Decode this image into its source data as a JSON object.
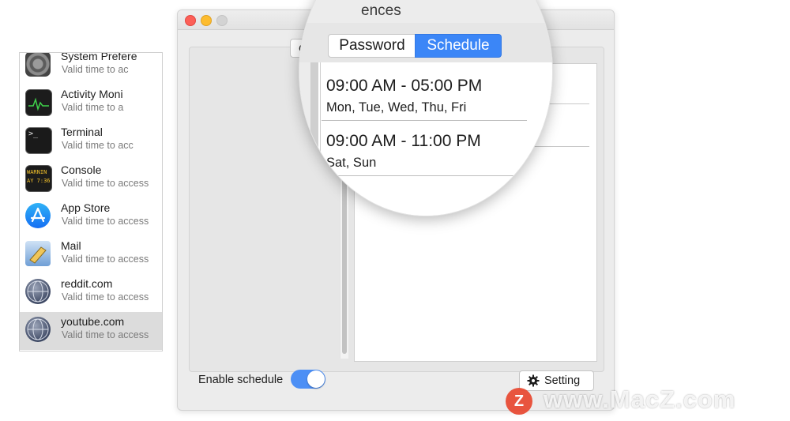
{
  "window": {
    "title_fragment": "ences",
    "tab_partial": "Gen"
  },
  "apps": [
    {
      "name": "System Prefere",
      "sub": "Valid time to ac",
      "icon": "system-preferences-icon"
    },
    {
      "name": "Activity Moni",
      "sub": "Valid time to a",
      "icon": "activity-monitor-icon"
    },
    {
      "name": "Terminal",
      "sub": "Valid time to acc",
      "icon": "terminal-icon"
    },
    {
      "name": "Console",
      "sub": "Valid time to access",
      "icon": "console-icon"
    },
    {
      "name": "App Store",
      "sub": "Valid time to access",
      "icon": "app-store-icon"
    },
    {
      "name": "Mail",
      "sub": "Valid time to access",
      "icon": "mail-icon"
    },
    {
      "name": "reddit.com",
      "sub": "Valid time to access",
      "icon": "globe-icon"
    },
    {
      "name": "youtube.com",
      "sub": "Valid time to access",
      "icon": "globe-icon",
      "selected": true
    }
  ],
  "icon_text": {
    "terminal": ">_",
    "console_line1": "WARNIN",
    "console_line2": "AY 7:36"
  },
  "magnifier": {
    "tabs": [
      {
        "label": "Password",
        "active": false
      },
      {
        "label": "Schedule",
        "active": true
      }
    ],
    "schedules": [
      {
        "time": "09:00 AM  -  05:00 PM",
        "days": "Mon, Tue, Wed, Thu, Fri"
      },
      {
        "time": "09:00 AM  -  11:00 PM",
        "days": "Sat, Sun"
      }
    ]
  },
  "footer": {
    "enable_label": "Enable schedule",
    "enable_on": true,
    "setting_label": "Setting"
  },
  "watermark": {
    "logo_letter": "Z",
    "text": "www.MacZ.com"
  },
  "colors": {
    "accent": "#3b86f7",
    "toggle": "#4c8ff5",
    "watermark_logo": "#e8442c"
  }
}
